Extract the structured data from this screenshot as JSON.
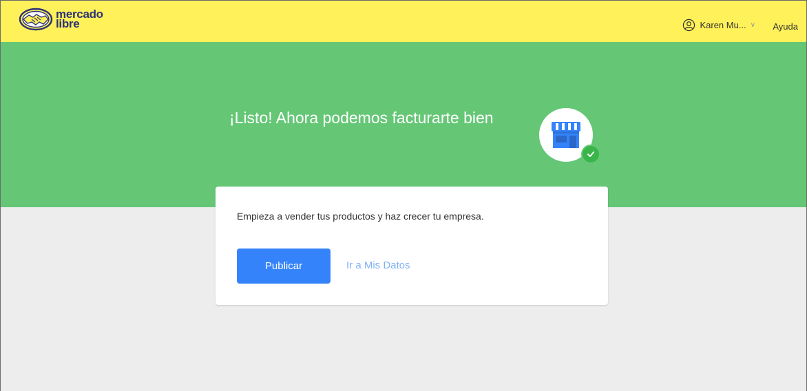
{
  "header": {
    "logo_line1": "mercado",
    "logo_line2": "libre",
    "user_name": "Karen Mu...",
    "help_label": "Ayuda"
  },
  "hero": {
    "title": "¡Listo! Ahora podemos facturarte bien"
  },
  "card": {
    "message": "Empieza a vender tus productos y haz crecer tu empresa.",
    "primary_button": "Publicar",
    "secondary_link": "Ir a Mis Datos"
  },
  "colors": {
    "header_yellow": "#fff159",
    "hero_green": "#65c776",
    "primary_blue": "#3483fa",
    "link_blue": "#80b1f7",
    "check_green": "#39b54a",
    "background": "#ededed"
  }
}
